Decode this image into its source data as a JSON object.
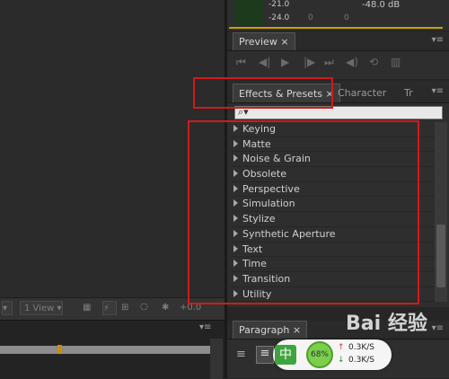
{
  "audio": {
    "levels": [
      "-21.0",
      "-24.0"
    ],
    "db_left": "0",
    "db_right": "0",
    "db_value": "-48.0 dB"
  },
  "preview": {
    "tab": "Preview",
    "close": "×",
    "menu": "▾≡",
    "controls": [
      "⏮",
      "◀|",
      "▶",
      "|▶",
      "⏭",
      "◀)",
      "⟲",
      "▥"
    ]
  },
  "effects": {
    "tabs": [
      {
        "label": "Effects & Presets",
        "close": "×"
      },
      {
        "label": "Character"
      },
      {
        "label": "Tr"
      }
    ],
    "menu": "▾≡",
    "search_icon": "⌕▾",
    "items": [
      "Keying",
      "Matte",
      "Noise & Grain",
      "Obsolete",
      "Perspective",
      "Simulation",
      "Stylize",
      "Synthetic Aperture",
      "Text",
      "Time",
      "Transition",
      "Utility"
    ]
  },
  "comp_toolbar": {
    "view_select": "1 View",
    "exposure": "+0.0"
  },
  "paragraph": {
    "tab": "Paragraph",
    "close": "×",
    "menu": "▾≡"
  },
  "timeline": {
    "menu": "▾≡"
  },
  "speed_widget": {
    "ime": "中",
    "percent": "68%",
    "up": "0.3K/S",
    "down": "0.3K/S",
    "up_arrow": "↑",
    "down_arrow": "↓"
  },
  "watermark": {
    "text": "Bai 经验"
  },
  "colors": {
    "highlight": "#d31919",
    "panel": "#2e2e2e"
  }
}
